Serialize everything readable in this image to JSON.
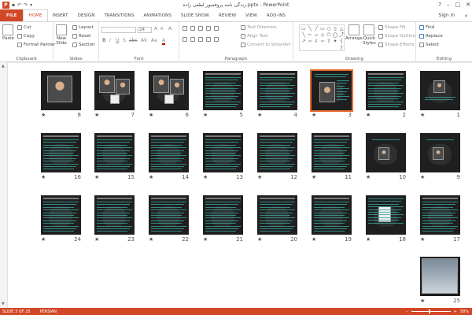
{
  "window": {
    "title": "زندگی نامه پروفسور لطفی زاده.pptx - PowerPoint",
    "help": "?",
    "min": "–",
    "max": "□",
    "close": "✕"
  },
  "qat": {
    "app_letter": "P",
    "save": "▪",
    "undo": "↶",
    "redo": "↷",
    "more": "▾"
  },
  "tabs": [
    "FILE",
    "HOME",
    "INSERT",
    "DESIGN",
    "TRANSITIONS",
    "ANIMATIONS",
    "SLIDE SHOW",
    "REVIEW",
    "VIEW",
    "ADD-INS"
  ],
  "active_tab": "HOME",
  "signin": "Sign in",
  "collapse": "▴",
  "ribbon": {
    "clipboard": {
      "label": "Clipboard",
      "paste": "Paste",
      "cut": "Cut",
      "copy": "Copy",
      "format_painter": "Format Painter"
    },
    "slides": {
      "label": "Slides",
      "new_slide_line1": "New",
      "new_slide_line2": "Slide",
      "layout": "Layout",
      "reset": "Reset",
      "section": "Section"
    },
    "font": {
      "label": "Font",
      "size": "24",
      "grow": "A",
      "shrink": "A",
      "clear": "A",
      "bold": "B",
      "italic": "I",
      "underline": "U",
      "strike": "S",
      "shadow": "abc",
      "spacing": "AV",
      "case": "Aa",
      "color": "A"
    },
    "paragraph": {
      "label": "Paragraph",
      "text_direction": "Text Direction",
      "align_text": "Align Text",
      "convert_smartart": "Convert to SmartArt"
    },
    "drawing": {
      "label": "Drawing",
      "arrange": "Arrange",
      "quick_styles_line1": "Quick",
      "quick_styles_line2": "Styles",
      "shape_fill": "Shape Fill",
      "shape_outline": "Shape Outline",
      "shape_effects": "Shape Effects"
    },
    "editing": {
      "label": "Editing",
      "find": "Find",
      "replace": "Replace",
      "select": "Select"
    }
  },
  "shapes_glyphs": [
    "▭",
    "╲",
    "╱",
    "▭",
    "○",
    "▯",
    "△",
    "╲",
    "⌐",
    "▱",
    "◇",
    "⬠",
    "◯",
    "⤴",
    "↗",
    "⇨",
    "⇩",
    "⇦",
    "⇧",
    "✦",
    "{ }"
  ],
  "slides": [
    {
      "num": "1",
      "star": "★",
      "kind": "title_photo"
    },
    {
      "num": "2",
      "star": "★",
      "kind": "text"
    },
    {
      "num": "3",
      "star": "★",
      "kind": "selected_photo"
    },
    {
      "num": "4",
      "star": "★",
      "kind": "text"
    },
    {
      "num": "5",
      "star": "★",
      "kind": "text"
    },
    {
      "num": "6",
      "star": "★",
      "kind": "photo_group"
    },
    {
      "num": "7",
      "star": "★",
      "kind": "photo_group"
    },
    {
      "num": "8",
      "star": "★",
      "kind": "portrait"
    },
    {
      "num": "9",
      "star": "★",
      "kind": "photo_small"
    },
    {
      "num": "10",
      "star": "★",
      "kind": "photo_small"
    },
    {
      "num": "11",
      "star": "★",
      "kind": "text"
    },
    {
      "num": "12",
      "star": "★",
      "kind": "text"
    },
    {
      "num": "13",
      "star": "★",
      "kind": "text"
    },
    {
      "num": "14",
      "star": "★",
      "kind": "text"
    },
    {
      "num": "15",
      "star": "★",
      "kind": "text"
    },
    {
      "num": "16",
      "star": "★",
      "kind": "text"
    },
    {
      "num": "17",
      "star": "★",
      "kind": "text"
    },
    {
      "num": "18",
      "star": "★",
      "kind": "white_photo"
    },
    {
      "num": "19",
      "star": "★",
      "kind": "text"
    },
    {
      "num": "20",
      "star": "★",
      "kind": "text"
    },
    {
      "num": "21",
      "star": "★",
      "kind": "text"
    },
    {
      "num": "22",
      "star": "★",
      "kind": "text"
    },
    {
      "num": "23",
      "star": "★",
      "kind": "text"
    },
    {
      "num": "24",
      "star": "★",
      "kind": "text"
    },
    {
      "num": "25",
      "star": "★",
      "kind": "laptop"
    }
  ],
  "selected_slide": "3",
  "status": {
    "slide": "SLIDE 3 OF 25",
    "language": "PERSIAN",
    "zoom": "58%",
    "minus": "–",
    "plus": "+"
  }
}
